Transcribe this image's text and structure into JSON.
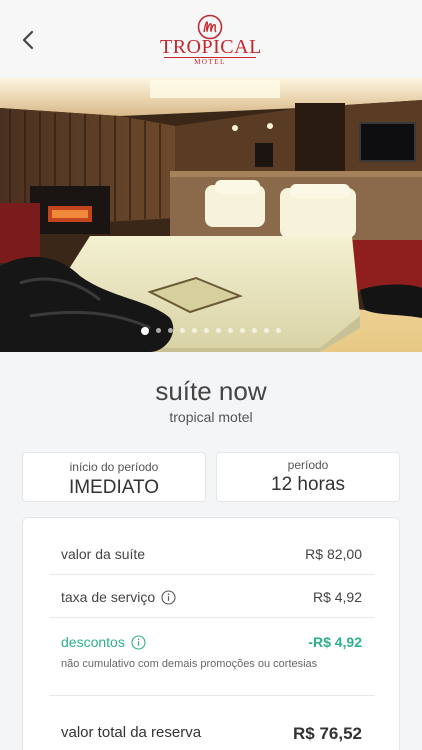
{
  "header": {
    "logo_text": "TROPICAL",
    "logo_sub": "MOTEL",
    "back_icon": "chevron-left-icon"
  },
  "gallery": {
    "page_count": 12,
    "active_index": 0
  },
  "suite": {
    "name": "suíte now",
    "motel": "tropical motel"
  },
  "start": {
    "label": "início do período",
    "value": "IMEDIATO"
  },
  "period": {
    "label": "período",
    "value": "12 horas"
  },
  "summary": {
    "suite_label": "valor da suíte",
    "suite_value": "R$ 82,00",
    "fee_label": "taxa de serviço",
    "fee_value": "R$ 4,92",
    "discount_label": "descontos",
    "discount_value": "-R$ 4,92",
    "discount_note": "não cumulativo com demais promoções ou cortesias",
    "total_label": "valor total da reserva",
    "total_value": "R$ 76,52"
  },
  "colors": {
    "brand": "#c3282e",
    "discount": "#2eaf8d"
  }
}
